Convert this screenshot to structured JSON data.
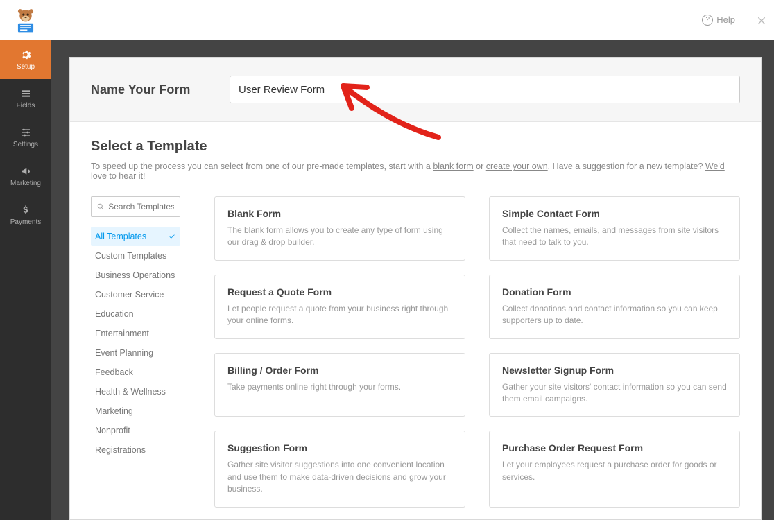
{
  "topbar": {
    "help_label": "Help"
  },
  "sidebar": {
    "items": [
      {
        "label": "Setup"
      },
      {
        "label": "Fields"
      },
      {
        "label": "Settings"
      },
      {
        "label": "Marketing"
      },
      {
        "label": "Payments"
      }
    ]
  },
  "form": {
    "name_label": "Name Your Form",
    "name_value": "User Review Form"
  },
  "template_picker": {
    "title": "Select a Template",
    "subtitle_prefix": "To speed up the process you can select from one of our pre-made templates, start with a ",
    "blank_link": "blank form",
    "or_text": " or ",
    "create_link": "create your own",
    "suggestion_prefix": ". Have a suggestion for a new template? ",
    "suggestion_link": "We'd love to hear it",
    "suggestion_suffix": "!"
  },
  "search": {
    "placeholder": "Search Templates"
  },
  "categories": [
    "All Templates",
    "Custom Templates",
    "Business Operations",
    "Customer Service",
    "Education",
    "Entertainment",
    "Event Planning",
    "Feedback",
    "Health & Wellness",
    "Marketing",
    "Nonprofit",
    "Registrations"
  ],
  "templates": [
    {
      "title": "Blank Form",
      "desc": "The blank form allows you to create any type of form using our drag & drop builder."
    },
    {
      "title": "Simple Contact Form",
      "desc": "Collect the names, emails, and messages from site visitors that need to talk to you."
    },
    {
      "title": "Request a Quote Form",
      "desc": "Let people request a quote from your business right through your online forms."
    },
    {
      "title": "Donation Form",
      "desc": "Collect donations and contact information so you can keep supporters up to date."
    },
    {
      "title": "Billing / Order Form",
      "desc": "Take payments online right through your forms."
    },
    {
      "title": "Newsletter Signup Form",
      "desc": "Gather your site visitors' contact information so you can send them email campaigns."
    },
    {
      "title": "Suggestion Form",
      "desc": "Gather site visitor suggestions into one convenient location and use them to make data-driven decisions and grow your business."
    },
    {
      "title": "Purchase Order Request Form",
      "desc": "Let your employees request a purchase order for goods or services."
    }
  ]
}
